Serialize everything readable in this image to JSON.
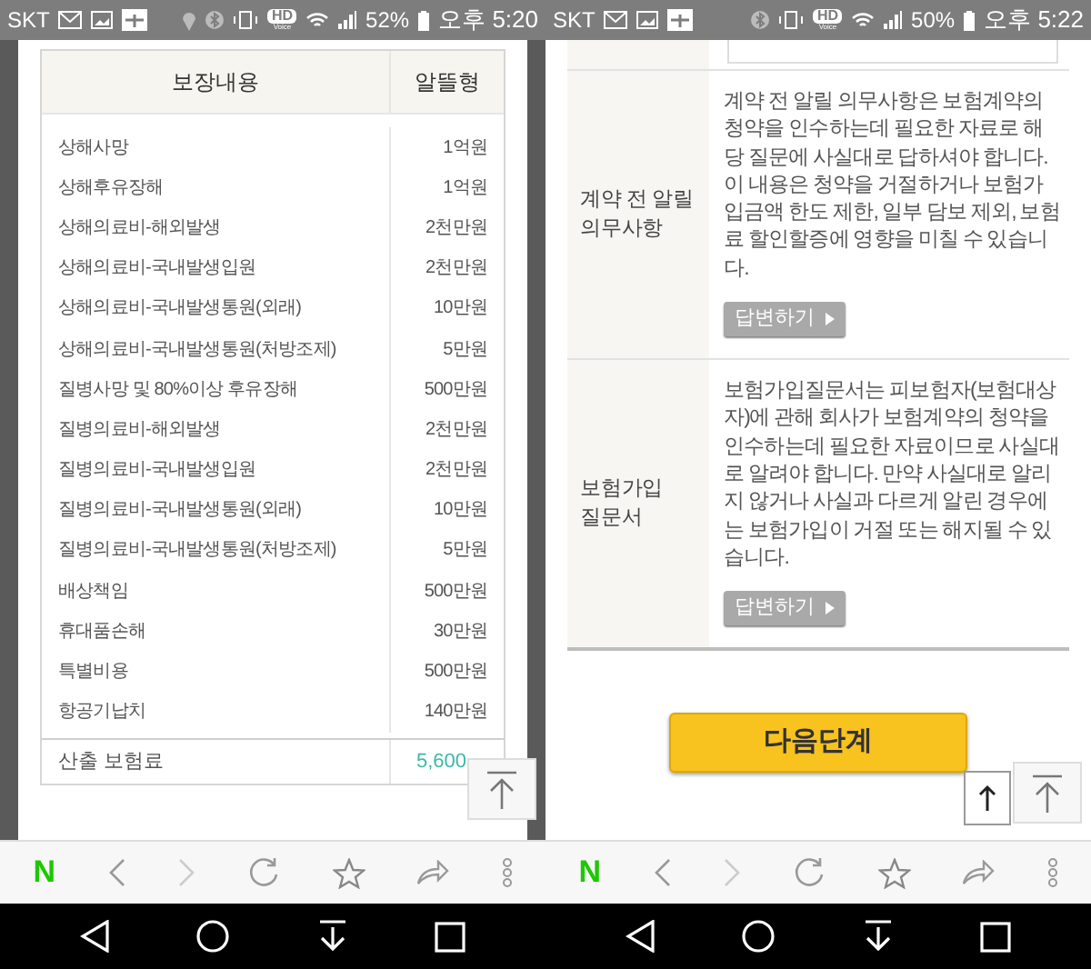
{
  "phones": [
    {
      "status_bar": {
        "carrier": "SKT",
        "location": true,
        "hd": "HD",
        "voice": "Voice",
        "battery": "52%",
        "time": "오후 5:20"
      },
      "screen": {
        "kind": "coverage_table",
        "columns": [
          "보장내용",
          "알뜰형"
        ],
        "rows": [
          {
            "item": "상해사망",
            "amount": "1억원"
          },
          {
            "item": "상해후유장해",
            "amount": "1억원"
          },
          {
            "item": "상해의료비-해외발생",
            "amount": "2천만원"
          },
          {
            "item": "상해의료비-국내발생입원",
            "amount": "2천만원"
          },
          {
            "item": "상해의료비-국내발생통원(외래)",
            "amount": "10만원"
          },
          {
            "item": "상해의료비-국내발생통원(처방조제)",
            "amount": "5만원"
          },
          {
            "item": "질병사망 및 80%이상 후유장해",
            "amount": "500만원"
          },
          {
            "item": "질병의료비-해외발생",
            "amount": "2천만원"
          },
          {
            "item": "질병의료비-국내발생입원",
            "amount": "2천만원"
          },
          {
            "item": "질병의료비-국내발생통원(외래)",
            "amount": "10만원"
          },
          {
            "item": "질병의료비-국내발생통원(처방조제)",
            "amount": "5만원"
          },
          {
            "item": "배상책임",
            "amount": "500만원"
          },
          {
            "item": "휴대품손해",
            "amount": "30만원"
          },
          {
            "item": "특별비용",
            "amount": "500만원"
          },
          {
            "item": "항공기납치",
            "amount": "140만원"
          }
        ],
        "total": {
          "label": "산출 보험료",
          "amount": "5,600"
        }
      },
      "browser_bar": {
        "logo": "N"
      }
    },
    {
      "status_bar": {
        "carrier": "SKT",
        "location": false,
        "hd": "HD",
        "voice": "Voice",
        "battery": "50%",
        "time": "오후 5:22"
      },
      "screen": {
        "kind": "disclosure",
        "sections": [
          {
            "title": "계약 전 알릴 의무사항",
            "text": "계약 전 알릴 의무사항은 보험계약의 청약을 인수하는데 필요한 자료로 해당 질문에 사실대로 답하셔야 합니다. 이 내용은 청약을 거절하거나 보험가입금액 한도 제한, 일부 담보 제외, 보험료 할인할증에 영향을 미칠 수 있습니다.",
            "button": "답변하기"
          },
          {
            "title": "보험가입 질문서",
            "text": "보험가입질문서는 피보험자(보험대상자)에 관해 회사가 보험계약의 청약을 인수하는데 필요한 자료이므로 사실대로 알려야 합니다. 만약 사실대로 알리지 않거나 사실과 다르게 알린 경우에는 보험가입이 거절 또는 해지될 수 있습니다.",
            "button": "답변하기"
          }
        ],
        "next_button": "다음단계",
        "scroll_up_button": true
      },
      "browser_bar": {
        "logo": "N"
      }
    }
  ]
}
